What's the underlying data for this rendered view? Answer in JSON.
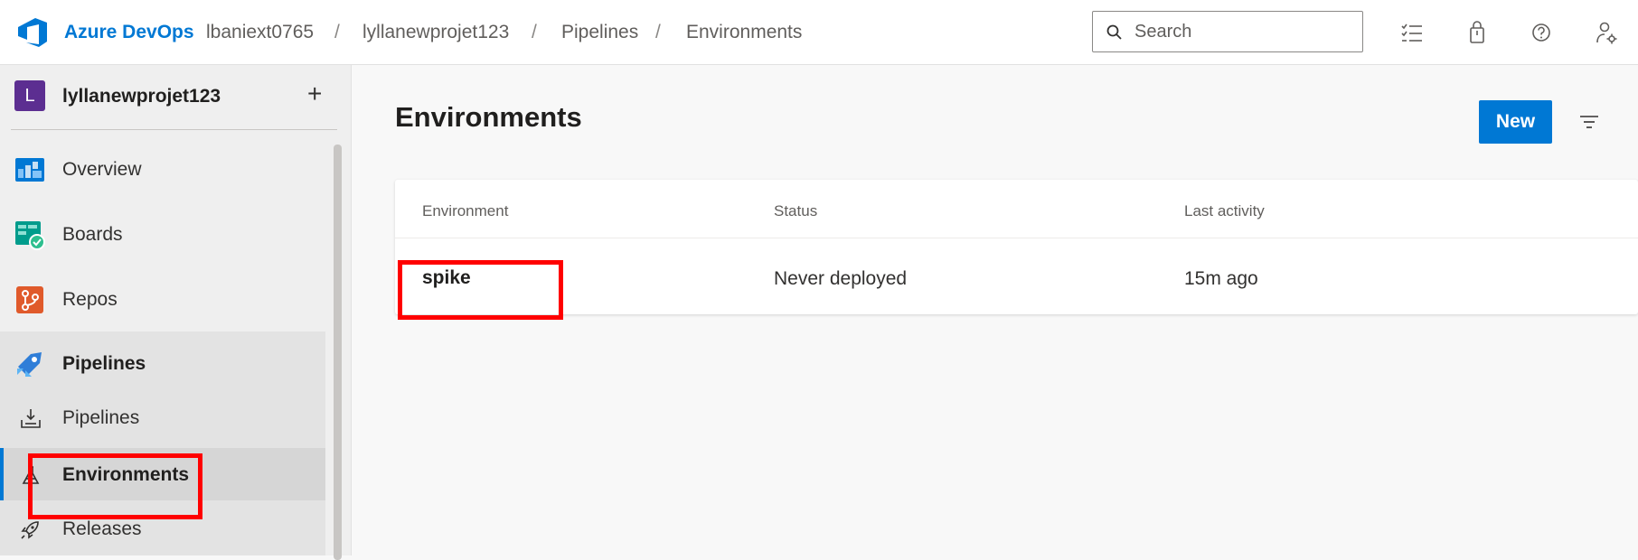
{
  "app": {
    "brand": "Azure DevOps",
    "accent_color": "#0078d4",
    "breadcrumb": [
      "lbaniext0765",
      "lyllanewprojet123",
      "Pipelines",
      "Environments"
    ],
    "breadcrumb_separator": "/"
  },
  "search": {
    "placeholder": "Search",
    "value": "",
    "icon": "search-icon"
  },
  "top_icons": [
    "task-list-icon",
    "shopping-bag-icon",
    "help-icon",
    "user-settings-icon"
  ],
  "project": {
    "avatar_letter": "L",
    "avatar_color": "#5c2e91",
    "name": "lyllanewprojet123",
    "add_label": "+"
  },
  "sidebar": {
    "items": [
      {
        "label": "Overview",
        "icon": "overview-icon"
      },
      {
        "label": "Boards",
        "icon": "boards-icon"
      },
      {
        "label": "Repos",
        "icon": "repos-icon"
      },
      {
        "label": "Pipelines",
        "icon": "pipelines-icon"
      }
    ],
    "sub_items": [
      {
        "label": "Pipelines",
        "icon": "pipelines-sub-icon"
      },
      {
        "label": "Environments",
        "icon": "environments-icon",
        "selected": true
      },
      {
        "label": "Releases",
        "icon": "releases-icon"
      }
    ]
  },
  "main": {
    "title": "Environments",
    "new_button": "New",
    "filter_icon": "filter-icon"
  },
  "table": {
    "columns": [
      "Environment",
      "Status",
      "Last activity"
    ],
    "rows": [
      {
        "environment": "spike",
        "status": "Never deployed",
        "last_activity": "15m ago"
      }
    ]
  },
  "annotations": {
    "highlight_color": "#ff0000"
  }
}
